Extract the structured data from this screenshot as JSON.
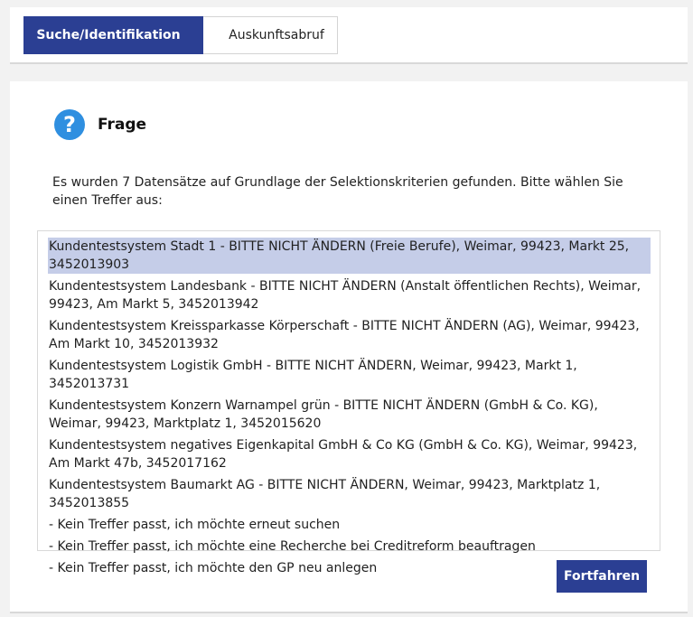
{
  "steps": {
    "active_label": "Suche/Identifikation",
    "next_label": "Auskunftsabruf"
  },
  "question": {
    "icon": "question-circle-icon",
    "title": "Frage",
    "text": "Es wurden 7 Datensätze auf Grundlage der Selektionskriterien gefunden. Bitte wählen Sie einen Treffer aus:"
  },
  "options": [
    "Kundentestsystem Stadt 1 - BITTE NICHT ÄNDERN (Freie Berufe), Weimar, 99423, Markt 25, 3452013903",
    "Kundentestsystem Landesbank - BITTE NICHT ÄNDERN (Anstalt öffentlichen Rechts), Weimar, 99423, Am Markt 5, 3452013942",
    "Kundentestsystem Kreissparkasse Körperschaft - BITTE NICHT ÄNDERN (AG), Weimar, 99423, Am Markt 10, 3452013932",
    "Kundentestsystem Logistik GmbH - BITTE NICHT ÄNDERN, Weimar, 99423, Markt 1, 3452013731",
    "Kundentestsystem Konzern Warnampel grün - BITTE NICHT ÄNDERN (GmbH & Co. KG), Weimar, 99423, Marktplatz 1, 3452015620",
    "Kundentestsystem negatives Eigenkapital GmbH & Co KG (GmbH & Co. KG), Weimar, 99423, Am Markt 47b, 3452017162",
    "Kundentestsystem Baumarkt AG - BITTE NICHT ÄNDERN, Weimar, 99423, Marktplatz 1, 3452013855",
    "- Kein Treffer passt, ich möchte erneut suchen",
    "- Kein Treffer passt, ich möchte eine Recherche bei Creditreform beauftragen",
    "- Kein Treffer passt, ich möchte den GP neu anlegen"
  ],
  "selected_index": 0,
  "colors": {
    "primary": "#2b3f93",
    "selected_row": "#c5cde8",
    "question_icon": "#2f8fe0"
  },
  "continue_label": "Fortfahren"
}
